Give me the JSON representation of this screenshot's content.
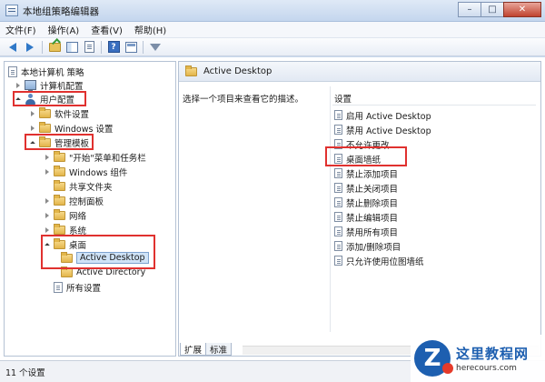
{
  "window": {
    "title": "本地组策略编辑器",
    "minimize": "–",
    "maximize": "□",
    "close": "✕"
  },
  "menu": [
    "文件(F)",
    "操作(A)",
    "查看(V)",
    "帮助(H)"
  ],
  "toolbar": {
    "icons": [
      "back-arrow-icon",
      "forward-arrow-icon",
      "up-folder-icon",
      "show-hide-tree-icon",
      "export-list-icon",
      "help-icon",
      "properties-icon",
      "filter-icon"
    ]
  },
  "tree": {
    "root": "本地计算机 策略",
    "computer_config": "计算机配置",
    "user_config": "用户配置",
    "software_settings": "软件设置",
    "windows_settings": "Windows 设置",
    "admin_templates": "管理模板",
    "start_menu_taskbar": "\"开始\"菜单和任务栏",
    "windows_components": "Windows 组件",
    "shared_folders": "共享文件夹",
    "control_panel": "控制面板",
    "network": "网络",
    "system": "系统",
    "desktop": "桌面",
    "active_desktop": "Active Desktop",
    "active_directory": "Active Directory",
    "all_settings": "所有设置"
  },
  "right_pane": {
    "header_title": "Active Desktop",
    "description": "选择一个项目来查看它的描述。",
    "column_header": "设置",
    "settings": [
      "启用 Active Desktop",
      "禁用 Active Desktop",
      "不允许更改",
      "桌面墙纸",
      "禁止添加项目",
      "禁止关闭项目",
      "禁止删除项目",
      "禁止编辑项目",
      "禁用所有项目",
      "添加/删除项目",
      "只允许使用位图墙纸"
    ],
    "tabs": [
      "扩展",
      "标准"
    ]
  },
  "status": {
    "text": "11 个设置"
  },
  "watermark": {
    "title": "这里教程网",
    "url": "herecours.com",
    "logo_letter": "Z"
  },
  "colors": {
    "highlight_box": "#e0312f",
    "selection": "#cfe3f7",
    "title_bar": "#c4d6ee"
  }
}
